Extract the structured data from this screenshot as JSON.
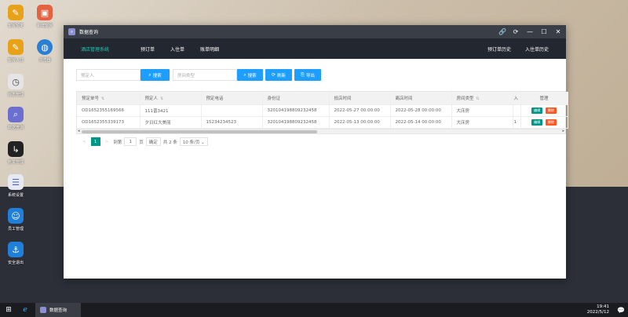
{
  "desktop": {
    "icons": [
      {
        "label": "客房预定",
        "icon": "notebook-icon",
        "color": "#e8a21a",
        "glyph": "✎"
      },
      {
        "label": "新增客房",
        "icon": "picture-icon",
        "color": "#e4623f",
        "glyph": "▣"
      },
      {
        "label": "客房入住",
        "icon": "checkin-icon",
        "color": "#e8a21a",
        "glyph": "✎"
      },
      {
        "label": "浏览器",
        "icon": "globe-icon",
        "color": "#2a7fd4",
        "glyph": "◍"
      },
      {
        "label": "房态管理",
        "icon": "clock-icon",
        "color": "#e5e5e5",
        "glyph": "◷"
      },
      {
        "label": "数据查询",
        "icon": "magnifier-icon",
        "color": "#6b6fd0",
        "glyph": "⌕"
      },
      {
        "label": "账单管理",
        "icon": "bill-icon",
        "color": "#222",
        "glyph": "↳"
      },
      {
        "label": "系统设置",
        "icon": "settings-icon",
        "color": "#4a62b8",
        "glyph": "☰"
      },
      {
        "label": "员工管理",
        "icon": "accessibility-icon",
        "color": "#1f7fd9",
        "glyph": "☺"
      },
      {
        "label": "安全退出",
        "icon": "anchor-icon",
        "color": "#1f7fd9",
        "glyph": "⚓"
      }
    ]
  },
  "window": {
    "title": "数据查询",
    "controls": [
      "🔗",
      "⟳",
      "—",
      "☐",
      "✕"
    ]
  },
  "nav": {
    "brand": "酒店管理系统",
    "items": [
      "预订单",
      "入住单",
      "账单明细"
    ],
    "right": [
      "预订单历史",
      "入住单历史"
    ]
  },
  "toolbar": {
    "booker_placeholder": "预定人",
    "search_label": "搜索",
    "roomtype_placeholder": "房间类型",
    "search2_label": "搜索",
    "refresh_label": "刷新",
    "export_label": "导出"
  },
  "table": {
    "columns": [
      "预定单号",
      "预定人",
      "预定电话",
      "身份证",
      "抵店时间",
      "离店时间",
      "房间类型",
      "入",
      "管理"
    ],
    "rows": [
      [
        "OD1652355169566",
        "111晋3421",
        "",
        "320104198809232458",
        "2022-05-27 00:00:00",
        "2022-05-28 00:00:00",
        "大床房",
        "",
        ""
      ],
      [
        "OD1652355339173",
        "夕日红大美丽",
        "15234234523",
        "320104198809232458",
        "2022-05-13 00:00:00",
        "2022-05-14 00:00:00",
        "大床房",
        "1",
        ""
      ]
    ],
    "edit_label": "编辑",
    "delete_label": "删除"
  },
  "pager": {
    "prev": "<",
    "current": "1",
    "next": ">",
    "goto_label": "到第",
    "page_value": "1",
    "page_unit": "页",
    "confirm": "确定",
    "total": "共 2 条",
    "per_page": "10 条/页 ⌄"
  },
  "taskbar": {
    "start_glyph": "⊞",
    "ie_glyph": "ℯ",
    "task_label": "数据查询",
    "time": "19:41",
    "date": "2022/5/12",
    "notif_glyph": "💬"
  }
}
